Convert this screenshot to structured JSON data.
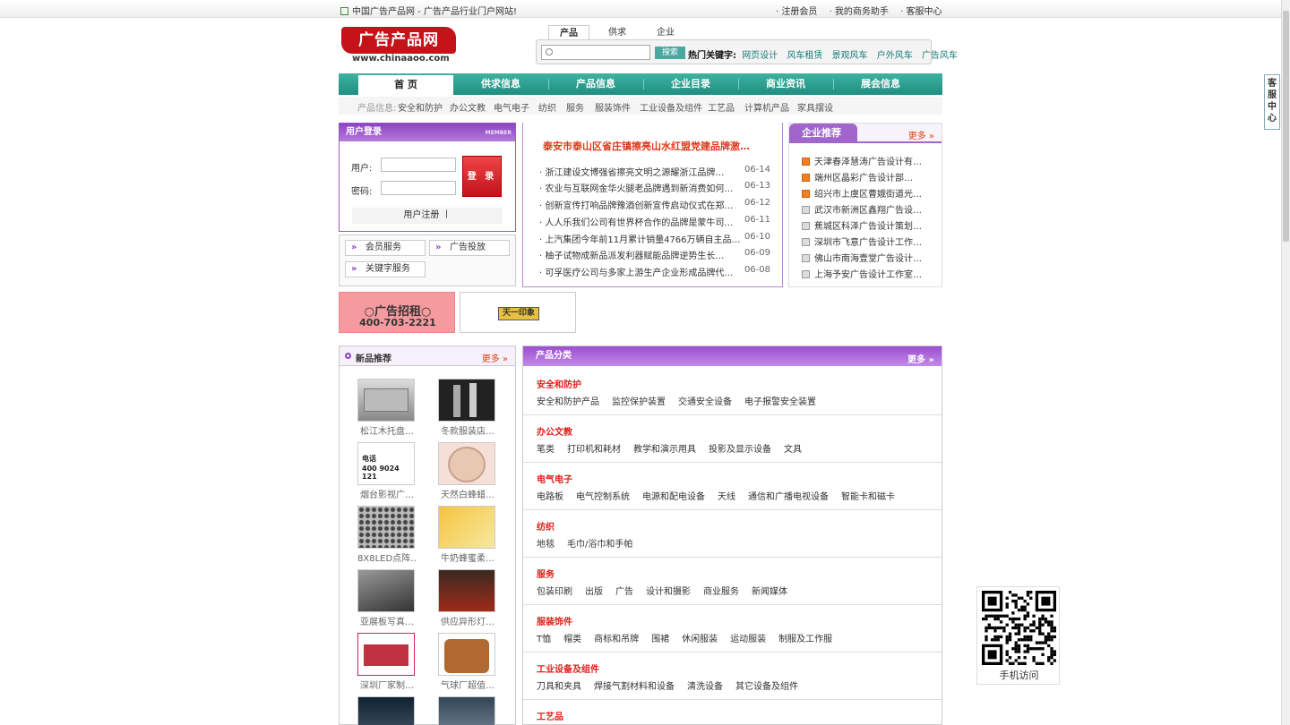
{
  "topbar": {
    "site_title": "中国广告产品网 - 广告产品行业门户网站!",
    "links": [
      "· 注册会员",
      "· 我的商务助手",
      "· 客服中心"
    ]
  },
  "logo": {
    "name": "广告产品网",
    "url": "www.chinaaoo.com"
  },
  "search": {
    "tabs": [
      "产品",
      "供求",
      "企业"
    ],
    "active_tab": "产品",
    "input_value": "",
    "button": "搜索",
    "hot_label": "热门关键字:",
    "hot_keywords": [
      "网页设计",
      "风车租赁",
      "景观风车",
      "户外风车",
      "广告风车"
    ]
  },
  "nav": {
    "items": [
      "首 页",
      "供求信息",
      "产品信息",
      "企业目录",
      "商业资讯",
      "展会信息"
    ],
    "active": "首 页"
  },
  "subnav": {
    "label": "产品信息:",
    "items": [
      "安全和防护",
      "办公文教",
      "电气电子",
      "纺织",
      "服务",
      "服装饰件",
      "工业设备及组件",
      "工艺品",
      "计算机产品",
      "家具摆设"
    ]
  },
  "login": {
    "title": "用户登录",
    "member": "MEMBER",
    "user_label": "用户:",
    "pass_label": "密码:",
    "user_value": "",
    "pass_value": "",
    "submit": "登 录",
    "register": "用户注册 丨"
  },
  "services": [
    "会员服务",
    "广告投放",
    "关键字服务"
  ],
  "headline_news": {
    "headline": "泰安市泰山区省庄镇擦亮山水红盟党建品牌激…",
    "items": [
      {
        "title": "· 浙江建设文博强省擦亮文明之源耀浙江品牌…",
        "date": "06-14"
      },
      {
        "title": "· 农业与互联网金华火腿老品牌遇到新消费如何…",
        "date": "06-13"
      },
      {
        "title": "· 创新宣传打响品牌豫酒创新宣传启动仪式在郑…",
        "date": "06-12"
      },
      {
        "title": "· 人人乐我们公司有世界杯合作的品牌是蒙牛司…",
        "date": "06-11"
      },
      {
        "title": "· 上汽集团今年前11月累计销量4766万辆自主品…",
        "date": "06-10"
      },
      {
        "title": "· 柚子试物成新品派发利器赋能品牌逆势生长…",
        "date": "06-09"
      },
      {
        "title": "· 可孚医疗公司与多家上游生产企业形成品牌代…",
        "date": "06-08"
      }
    ]
  },
  "company": {
    "title": "企业推荐",
    "more": "更多 »",
    "items": [
      "天津春泽慧涛广告设计有…",
      "端州区晶彩广告设计部…",
      "绍兴市上虞区曹娥街道光…",
      "武汉市新洲区鑫翔广告设…",
      "蕉城区科泽广告设计策划…",
      "深圳市飞意广告设计工作…",
      "佛山市南海壹堂广告设计…",
      "上海予安广告设计工作室…"
    ]
  },
  "ads": {
    "ad1_line1": "○广告招租○",
    "ad1_line2": "400-703-2221",
    "ad2_text": "天一印象"
  },
  "new_products": {
    "title": "新品推荐",
    "more": "更多 »",
    "items": [
      {
        "name": "松江木托盘…",
        "img": "pallet",
        "phone": ""
      },
      {
        "name": "冬款服装店…",
        "img": "stands",
        "phone": ""
      },
      {
        "name": "烟台影视广…",
        "img": "phone-card",
        "phone_label": "电话",
        "phone": "400 9024 121"
      },
      {
        "name": "天然白蜂蜡…",
        "img": "wax",
        "phone": ""
      },
      {
        "name": "8X8LED点阵…",
        "img": "led",
        "phone": ""
      },
      {
        "name": "牛奶蜂蜜柔…",
        "img": "honey",
        "phone": ""
      },
      {
        "name": "亚展板写真…",
        "img": "panel",
        "phone": ""
      },
      {
        "name": "供应异形灯…",
        "img": "lamp",
        "phone": ""
      },
      {
        "name": "深圳厂家制…",
        "img": "bag",
        "phone": ""
      },
      {
        "name": "气球厂超值…",
        "img": "balloon",
        "phone": ""
      }
    ]
  },
  "categories": {
    "title": "产品分类",
    "more": "更多 »",
    "blocks": [
      {
        "name": "安全和防护",
        "subs": [
          "安全和防护产品",
          "监控保护装置",
          "交通安全设备",
          "电子报警安全装置"
        ]
      },
      {
        "name": "办公文教",
        "subs": [
          "笔类",
          "打印机和耗材",
          "教学和演示用具",
          "投影及显示设备",
          "文具"
        ]
      },
      {
        "name": "电气电子",
        "subs": [
          "电路板",
          "电气控制系统",
          "电源和配电设备",
          "天线",
          "通信和广播电视设备",
          "智能卡和磁卡"
        ]
      },
      {
        "name": "纺织",
        "subs": [
          "地毯",
          "毛巾/浴巾和手帕"
        ]
      },
      {
        "name": "服务",
        "subs": [
          "包装印刷",
          "出版",
          "广告",
          "设计和摄影",
          "商业服务",
          "新闻媒体"
        ]
      },
      {
        "name": "服装饰件",
        "subs": [
          "T恤",
          "帽类",
          "商标和吊牌",
          "围裙",
          "休闲服装",
          "运动服装",
          "制服及工作服"
        ]
      },
      {
        "name": "工业设备及组件",
        "subs": [
          "刀具和夹具",
          "焊接气割材料和设备",
          "清洗设备",
          "其它设备及组件"
        ]
      },
      {
        "name": "工艺品",
        "subs": []
      }
    ]
  },
  "qr": {
    "label": "手机访问"
  },
  "side_tab": [
    "客",
    "服",
    "中",
    "心"
  ],
  "colors": {
    "nav": "#2a9d8f",
    "accent_purple": "#9b4fd0",
    "category_red": "#e0201a",
    "news_red": "#e03a1a"
  }
}
